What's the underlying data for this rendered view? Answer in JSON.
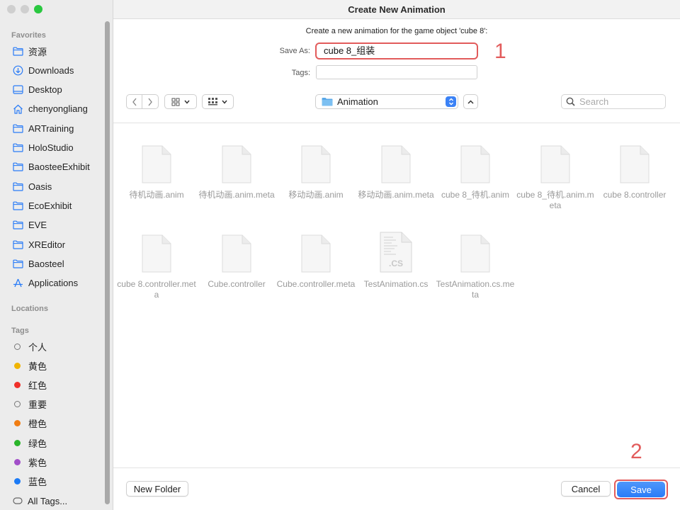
{
  "window": {
    "title": "Create New Animation"
  },
  "sidebar": {
    "favorites_label": "Favorites",
    "favorites": [
      {
        "label": "资源",
        "icon": "folder-icon"
      },
      {
        "label": "Downloads",
        "icon": "download-icon"
      },
      {
        "label": "Desktop",
        "icon": "desktop-icon"
      },
      {
        "label": "chenyongliang",
        "icon": "home-icon"
      },
      {
        "label": "ARTraining",
        "icon": "folder-icon"
      },
      {
        "label": "HoloStudio",
        "icon": "folder-icon"
      },
      {
        "label": "BaosteeExhibit",
        "icon": "folder-icon"
      },
      {
        "label": "Oasis",
        "icon": "folder-icon"
      },
      {
        "label": "EcoExhibit",
        "icon": "folder-icon"
      },
      {
        "label": "EVE",
        "icon": "folder-icon"
      },
      {
        "label": "XREditor",
        "icon": "folder-icon"
      },
      {
        "label": "Baosteel",
        "icon": "folder-icon"
      },
      {
        "label": "Applications",
        "icon": "applications-icon"
      }
    ],
    "locations_label": "Locations",
    "tags_label": "Tags",
    "tags": [
      {
        "label": "个人",
        "color": "ring"
      },
      {
        "label": "黄色",
        "color": "#f0b400"
      },
      {
        "label": "红色",
        "color": "#f0302a"
      },
      {
        "label": "重要",
        "color": "ring"
      },
      {
        "label": "橙色",
        "color": "#f07d12"
      },
      {
        "label": "绿色",
        "color": "#2ab52a"
      },
      {
        "label": "紫色",
        "color": "#a24fc9"
      },
      {
        "label": "蓝色",
        "color": "#1c7bf6"
      }
    ],
    "all_tags": "All Tags..."
  },
  "dialog": {
    "prompt": "Create a new animation for the game object 'cube 8':",
    "save_as_label": "Save As:",
    "save_as_value": "cube 8_组装",
    "tags_label": "Tags:",
    "location": "Animation",
    "search_placeholder": "Search"
  },
  "annotations": {
    "step1": "1",
    "step2": "2"
  },
  "files": [
    {
      "name": "待机动画.anim",
      "type": "doc"
    },
    {
      "name": "待机动画.anim.meta",
      "type": "doc"
    },
    {
      "name": "移动动画.anim",
      "type": "doc"
    },
    {
      "name": "移动动画.anim.meta",
      "type": "doc"
    },
    {
      "name": "cube 8_待机.anim",
      "type": "doc"
    },
    {
      "name": "cube 8_待机.anim.meta",
      "type": "doc"
    },
    {
      "name": "cube 8.controller",
      "type": "doc"
    },
    {
      "name": "cube 8.controller.meta",
      "type": "doc"
    },
    {
      "name": "Cube.controller",
      "type": "doc"
    },
    {
      "name": "Cube.controller.meta",
      "type": "doc"
    },
    {
      "name": "TestAnimation.cs",
      "type": "cs",
      "ext": ".CS"
    },
    {
      "name": "TestAnimation.cs.meta",
      "type": "doc"
    }
  ],
  "buttons": {
    "new_folder": "New Folder",
    "cancel": "Cancel",
    "save": "Save"
  },
  "colors": {
    "accent": "#2a7cf7",
    "annotation": "#e25b5b"
  }
}
